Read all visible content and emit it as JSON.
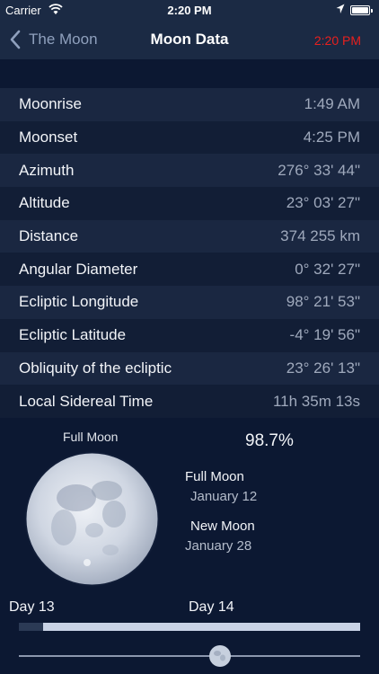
{
  "status_bar": {
    "carrier": "Carrier",
    "time": "2:20 PM",
    "icons": [
      "wifi-icon",
      "location-arrow-icon",
      "battery-icon"
    ]
  },
  "nav": {
    "back_label": "The Moon",
    "title": "Moon Data",
    "current_time": "2:20 PM"
  },
  "rows": [
    {
      "label": "Moonrise",
      "value": "1:49 AM"
    },
    {
      "label": "Moonset",
      "value": "4:25 PM"
    },
    {
      "label": "Azimuth",
      "value": "276° 33' 44\""
    },
    {
      "label": "Altitude",
      "value": "23° 03' 27\""
    },
    {
      "label": "Distance",
      "value": "374 255 km"
    },
    {
      "label": "Angular Diameter",
      "value": "0° 32' 27\""
    },
    {
      "label": "Ecliptic Longitude",
      "value": "98° 21' 53\""
    },
    {
      "label": "Ecliptic Latitude",
      "value": "-4° 19' 56\""
    },
    {
      "label": "Obliquity of the ecliptic",
      "value": "23° 26' 13\""
    },
    {
      "label": "Local Sidereal Time",
      "value": "11h 35m 13s"
    }
  ],
  "phase": {
    "name": "Full Moon",
    "illumination": "98.7%",
    "next_full_label": "Full Moon",
    "next_full_date": "January  12",
    "next_new_label": "New Moon",
    "next_new_date": "January  28"
  },
  "timeline": {
    "day_start": "Day 13",
    "day_end": "Day 14",
    "progress_fraction": 0.07,
    "slider_fraction": 0.59
  },
  "colors": {
    "background": "#0c1832",
    "bar": "#1b2a44",
    "accent_red": "#e8201e",
    "row_odd": "#1a2741",
    "row_even": "#121e36"
  }
}
